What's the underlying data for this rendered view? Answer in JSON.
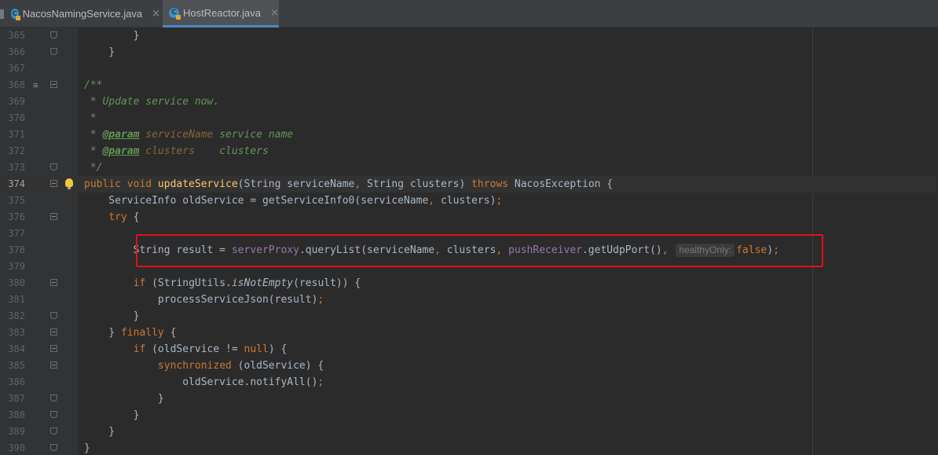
{
  "tabs": [
    {
      "label": "NacosNamingService.java",
      "icon": "java-class-icon",
      "close": "×"
    },
    {
      "label": "HostReactor.java",
      "icon": "java-class-icon",
      "close": "×",
      "active": true
    }
  ],
  "editor": {
    "lines": [
      {
        "num": "365"
      },
      {
        "num": "366"
      },
      {
        "num": "367"
      },
      {
        "num": "368"
      },
      {
        "num": "369"
      },
      {
        "num": "370"
      },
      {
        "num": "371"
      },
      {
        "num": "372"
      },
      {
        "num": "373"
      },
      {
        "num": "374"
      },
      {
        "num": "375"
      },
      {
        "num": "376"
      },
      {
        "num": "377"
      },
      {
        "num": "378"
      },
      {
        "num": "379"
      },
      {
        "num": "380"
      },
      {
        "num": "381"
      },
      {
        "num": "382"
      },
      {
        "num": "383"
      },
      {
        "num": "384"
      },
      {
        "num": "385"
      },
      {
        "num": "386"
      },
      {
        "num": "387"
      },
      {
        "num": "388"
      },
      {
        "num": "389"
      },
      {
        "num": "390"
      }
    ],
    "caret_line": "374",
    "inlay_hint": "healthyOnly:",
    "colors": {
      "keyword": "#cc7832",
      "function": "#ffc66d",
      "comment": "#629755",
      "field": "#9876aa",
      "text": "#a9b7c6",
      "background": "#2b2b2b",
      "highlight_box": "#e0101a"
    }
  }
}
